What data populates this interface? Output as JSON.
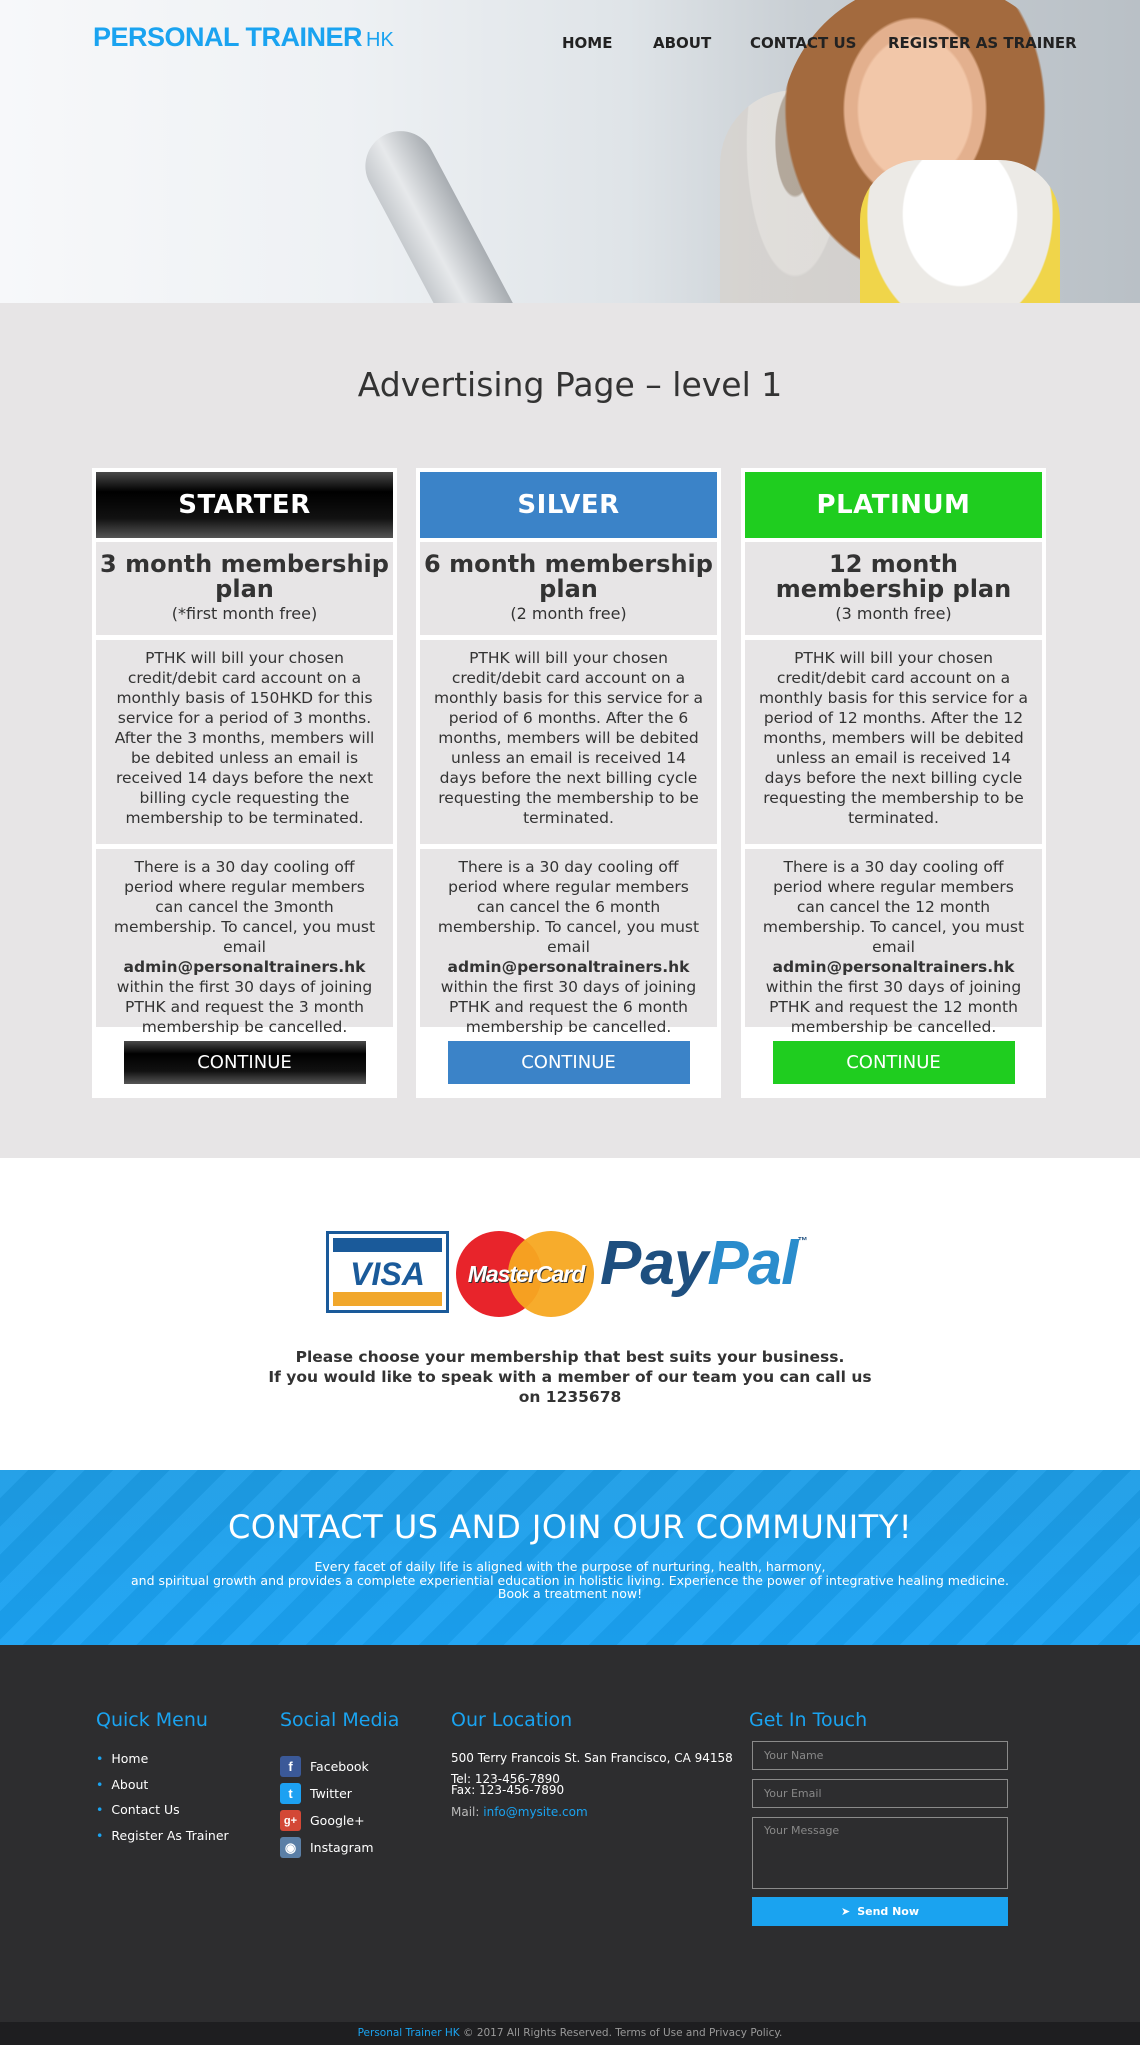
{
  "header": {
    "logo_main": "PERSONAL TRAINER",
    "logo_sub": "HK",
    "nav": [
      "HOME",
      "ABOUT",
      "CONTACT US",
      "REGISTER AS TRAINER"
    ]
  },
  "pricing": {
    "title": "Advertising Page – level 1",
    "plans": [
      {
        "name": "STARTER",
        "plan": "3 month membership plan",
        "note": "(*first month free)",
        "billing": "PTHK will bill your chosen credit/debit card account on a monthly basis of 150HKD for this service for a period of 3 months. After the 3 months, members will be debited unless an email is received 14 days before the next billing cycle requesting the membership to be terminated.",
        "cooling_pre": "There is a 30 day cooling off period where regular members can cancel the 3month membership. To cancel, you must email",
        "email": "admin@personaltrainers.hk",
        "cooling_post": "within the first 30 days of joining PTHK and request the 3 month membership be cancelled.",
        "button": "CONTINUE"
      },
      {
        "name": "SILVER",
        "plan": "6 month membership plan",
        "note": "(2 month free)",
        "billing": "PTHK will bill your chosen credit/debit card account on a monthly basis for this service for a period of 6 months. After the 6 months, members will be debited unless an email is received 14 days before the next billing cycle requesting the membership to be terminated.",
        "cooling_pre": "There is a 30 day cooling off period where regular members can cancel the 6 month membership. To cancel, you must email",
        "email": "admin@personaltrainers.hk",
        "cooling_post": "within the first 30 days of joining PTHK and request the 6 month membership be cancelled.",
        "button": "CONTINUE"
      },
      {
        "name": "PLATINUM",
        "plan": "12 month membership plan",
        "note": "(3 month free)",
        "billing": "PTHK will bill your chosen credit/debit card account on a monthly basis for this service for a period of 12 months. After the 12 months, members will be debited unless an email is received 14 days before the next billing cycle requesting the membership to be terminated.",
        "cooling_pre": "There is a 30 day cooling off period where regular members can cancel the 12 month membership. To cancel, you must email",
        "email": "admin@personaltrainers.hk",
        "cooling_post": "within the first 30 days of joining PTHK and request the 12 month membership be cancelled.",
        "button": "CONTINUE"
      }
    ]
  },
  "payment": {
    "visa": "VISA",
    "mastercard": "MasterCard",
    "paypal_a": "Pay",
    "paypal_b": "Pal",
    "paypal_tm": "™",
    "line1": "Please choose your membership that best suits your business.",
    "line2": "If you would like to speak with a member of our team you can call us",
    "line3": "on 1235678"
  },
  "banner": {
    "title": "CONTACT US AND JOIN OUR COMMUNITY!",
    "line1": "Every facet of daily life is aligned with the purpose of nurturing, health, harmony,",
    "line2": "and spiritual growth and provides a complete experiential education in holistic living. Experience the power of integrative healing medicine.",
    "line3": "Book a treatment now!"
  },
  "footer": {
    "quick_title": "Quick Menu",
    "quick_items": [
      "Home",
      "About",
      "Contact Us",
      "Register As Trainer"
    ],
    "social_title": "Social Media",
    "social_items": [
      "Facebook",
      "Twitter",
      "Google+",
      "Instagram"
    ],
    "location_title": "Our Location",
    "address": "500 Terry Francois St. San Francisco, CA 94158",
    "tel": "Tel: 123-456-7890",
    "fax": "Fax: 123-456-7890",
    "mail_label": "Mail:",
    "mail": "info@mysite.com",
    "touch_title": "Get In Touch",
    "name_placeholder": "Your Name",
    "email_placeholder": "Your Email",
    "message_placeholder": "Your Message",
    "send": "Send Now"
  },
  "copyright": {
    "brand": "Personal Trainer HK",
    "text": "© 2017 All Rights Reserved. Terms of Use and Privacy Policy."
  },
  "colors": {
    "brand_blue": "#1aa3f0",
    "silver": "#3b83c8",
    "platinum": "#1fcd1f",
    "starter": "#000000"
  }
}
